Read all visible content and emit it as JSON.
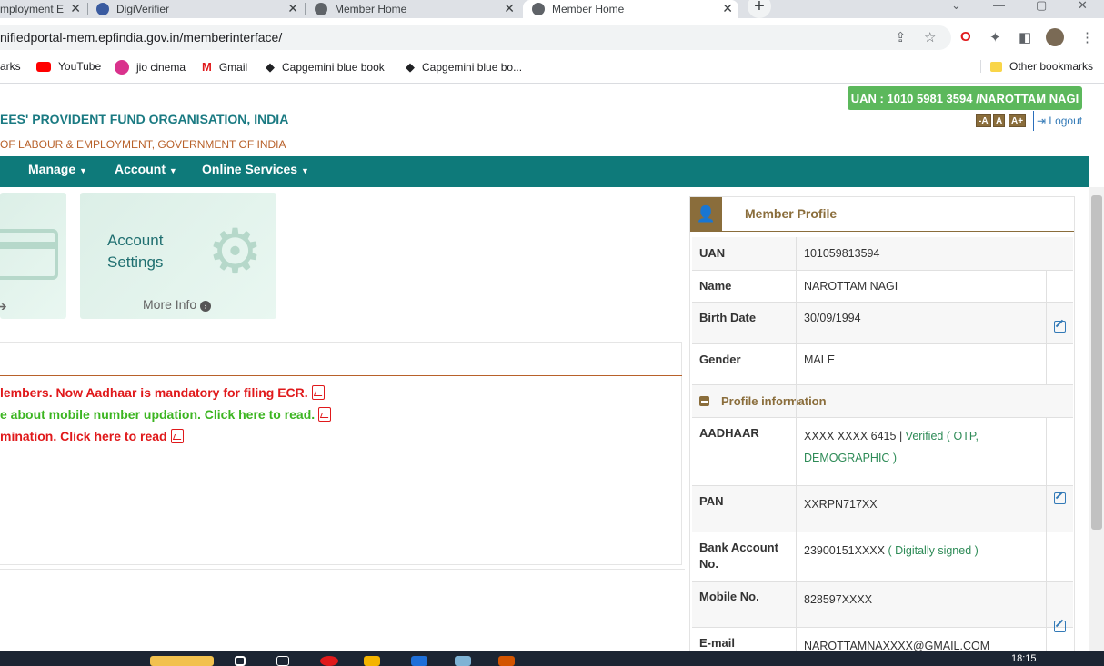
{
  "browser": {
    "tabs": [
      {
        "title": "mployment E",
        "active": false
      },
      {
        "title": "DigiVerifier",
        "active": false
      },
      {
        "title": "Member Home",
        "active": false
      },
      {
        "title": "Member Home",
        "active": true
      }
    ],
    "url": "nifiedportal-mem.epfindia.gov.in/memberinterface/",
    "bookmarks": [
      {
        "label": "arks",
        "icon": "bookmark-icon"
      },
      {
        "label": "YouTube",
        "icon": "youtube-icon"
      },
      {
        "label": "jio cinema",
        "icon": "jio-cinema-icon"
      },
      {
        "label": "Gmail",
        "icon": "gmail-icon"
      },
      {
        "label": "Capgemini blue book",
        "icon": "capgemini-icon"
      },
      {
        "label": "Capgemini blue bo...",
        "icon": "capgemini-icon"
      }
    ],
    "other_bookmarks": "Other bookmarks"
  },
  "header": {
    "uan_badge": "UAN : 1010 5981 3594 /NAROTTAM NAGI",
    "font_buttons": [
      "-A",
      "A",
      "A+"
    ],
    "logout": "Logout",
    "org_title": "EES' PROVIDENT FUND ORGANISATION, INDIA",
    "org_subtitle": "OF LABOUR & EMPLOYMENT, GOVERNMENT OF INDIA"
  },
  "nav": {
    "items": [
      "Manage",
      "Account",
      "Online Services"
    ]
  },
  "tiles": {
    "account_settings_line1": "Account",
    "account_settings_line2": "Settings",
    "more_info": "More Info"
  },
  "notices": [
    {
      "text": "lembers. Now Aadhaar is mandatory for filing ECR.",
      "color": "#e0191b"
    },
    {
      "text": "e about mobile number updation. Click here to read.",
      "color": "#3cb521"
    },
    {
      "text": "mination. Click here to read",
      "color": "#e0191b"
    }
  ],
  "profile": {
    "title": "Member Profile",
    "uan_label": "UAN",
    "uan": "101059813594",
    "name_label": "Name",
    "name": "NAROTTAM NAGI",
    "birth_label": "Birth Date",
    "birth": "30/09/1994",
    "gender_label": "Gender",
    "gender": "MALE",
    "section": "Profile information",
    "aadhaar_label": "AADHAAR",
    "aadhaar": "XXXX XXXX 6415",
    "aadhaar_sep": "|",
    "aadhaar_status_1": "Verified ( OTP,",
    "aadhaar_status_2": "DEMOGRAPHIC )",
    "pan_label": "PAN",
    "pan": "XXRPN717XX",
    "bank_label_1": "Bank Account",
    "bank_label_2": "No.",
    "bank": "23900151XXXX",
    "bank_status": "( Digitally signed )",
    "mobile_label": "Mobile No.",
    "mobile": "828597XXXX",
    "email_label": "E-mail",
    "email": "NAROTTAMNAXXXX@GMAIL.COM"
  },
  "taskbar": {
    "time": "18:15"
  }
}
